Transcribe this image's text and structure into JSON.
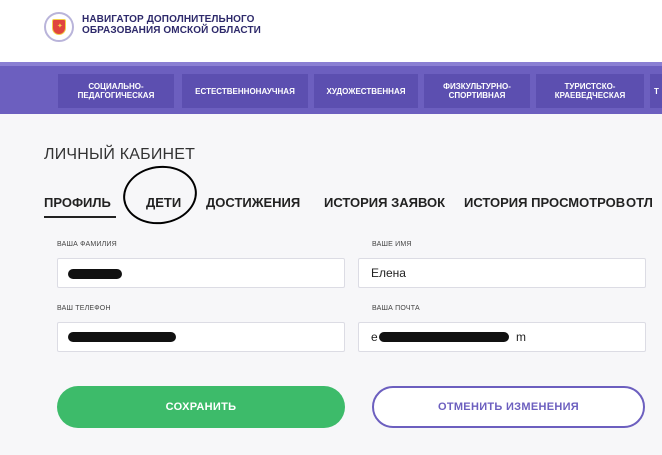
{
  "header": {
    "logo_line1": "НАВИГАТОР ДОПОЛНИТЕЛЬНОГО",
    "logo_line2": "ОБРАЗОВАНИЯ ОМСКОЙ ОБЛАСТИ",
    "logo_icon": "coat-of-arms-icon"
  },
  "nav": {
    "items": [
      {
        "line1": "СОЦИАЛЬНО-",
        "line2": "ПЕДАГОГИЧЕСКАЯ"
      },
      {
        "line1": "ЕСТЕСТВЕННОНАУЧНАЯ",
        "line2": ""
      },
      {
        "line1": "ХУДОЖЕСТВЕННАЯ",
        "line2": ""
      },
      {
        "line1": "ФИЗКУЛЬТУРНО-",
        "line2": "СПОРТИВНАЯ"
      },
      {
        "line1": "ТУРИСТСКО-",
        "line2": "КРАЕВЕДЧЕСКАЯ"
      },
      {
        "line1": "Т",
        "line2": ""
      }
    ]
  },
  "page": {
    "title": "ЛИЧНЫЙ КАБИНЕТ"
  },
  "tabs": [
    {
      "label": "ПРОФИЛЬ"
    },
    {
      "label": "ДЕТИ"
    },
    {
      "label": "ДОСТИЖЕНИЯ"
    },
    {
      "label": "ИСТОРИЯ ЗАЯВОК"
    },
    {
      "label": "ИСТОРИЯ ПРОСМОТРОВ"
    },
    {
      "label": "ОТЛ"
    }
  ],
  "form": {
    "surname_label": "ВАША ФАМИЛИЯ",
    "name_label": "ВАШЕ ИМЯ",
    "name_value": "Елена",
    "phone_label": "ВАШ ТЕЛЕФОН",
    "email_label": "ВАША ПОЧТА",
    "email_visible_start": "e",
    "email_visible_end": "m"
  },
  "buttons": {
    "save": "СОХРАНИТЬ",
    "cancel": "ОТМЕНИТЬ ИЗМЕНЕНИЯ"
  },
  "colors": {
    "nav_bg": "#6c5fbf",
    "save_bg": "#3dbb6a",
    "cancel_border": "#6c5fbf"
  }
}
